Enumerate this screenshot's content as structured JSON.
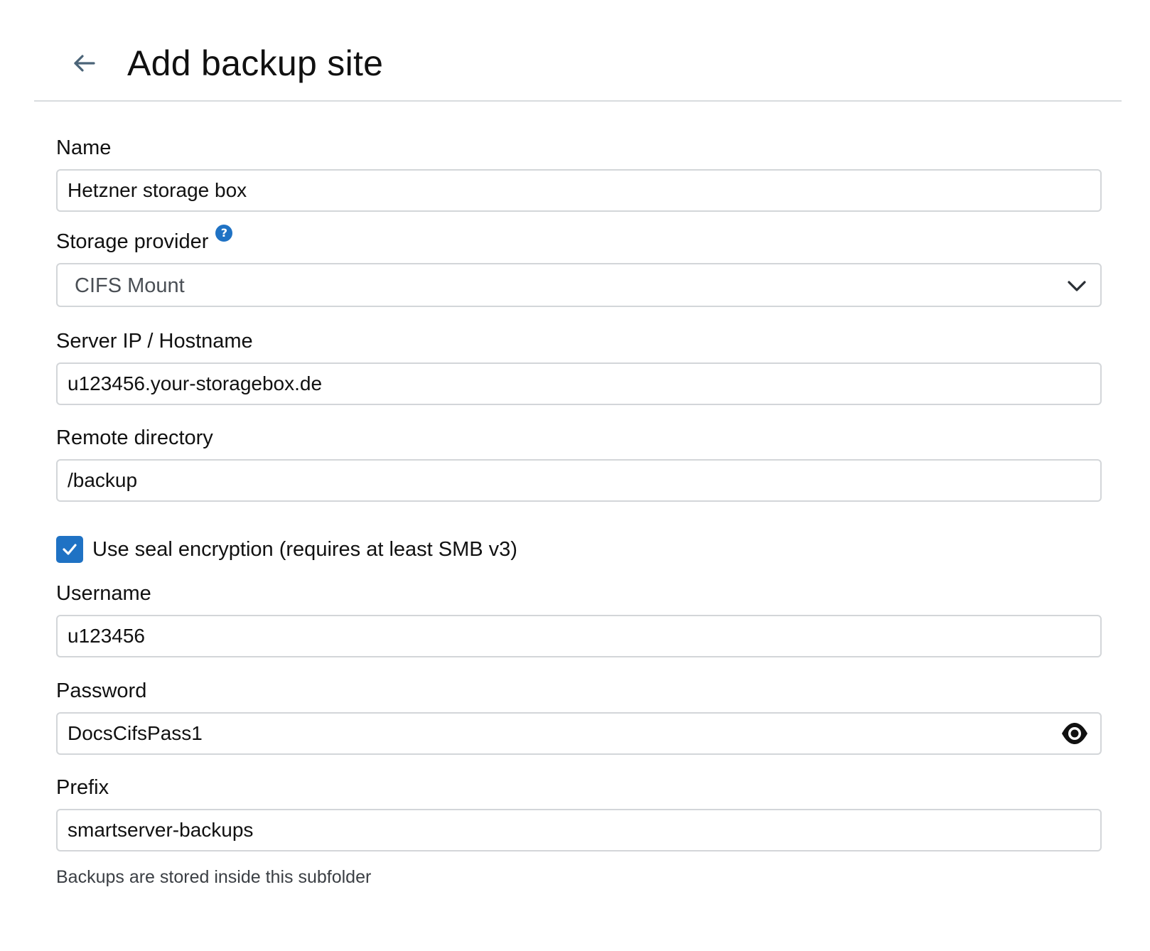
{
  "header": {
    "title": "Add backup site",
    "back_icon": "arrow-left-icon"
  },
  "form": {
    "name": {
      "label": "Name",
      "value": "Hetzner storage box"
    },
    "storage_provider": {
      "label": "Storage provider",
      "help_glyph": "?",
      "selected": "CIFS Mount"
    },
    "server": {
      "label": "Server IP / Hostname",
      "value": "u123456.your-storagebox.de"
    },
    "remote_directory": {
      "label": "Remote directory",
      "value": "/backup"
    },
    "seal_encryption": {
      "label": "Use seal encryption (requires at least SMB v3)",
      "checked": true
    },
    "username": {
      "label": "Username",
      "value": "u123456"
    },
    "password": {
      "label": "Password",
      "value": "DocsCifsPass1",
      "toggle_icon": "eye-icon"
    },
    "prefix": {
      "label": "Prefix",
      "value": "smartserver-backups",
      "help": "Backups are stored inside this subfolder"
    }
  },
  "colors": {
    "accent": "#1f72c4",
    "border": "#d3d6d9",
    "divider": "#d9dcde"
  }
}
